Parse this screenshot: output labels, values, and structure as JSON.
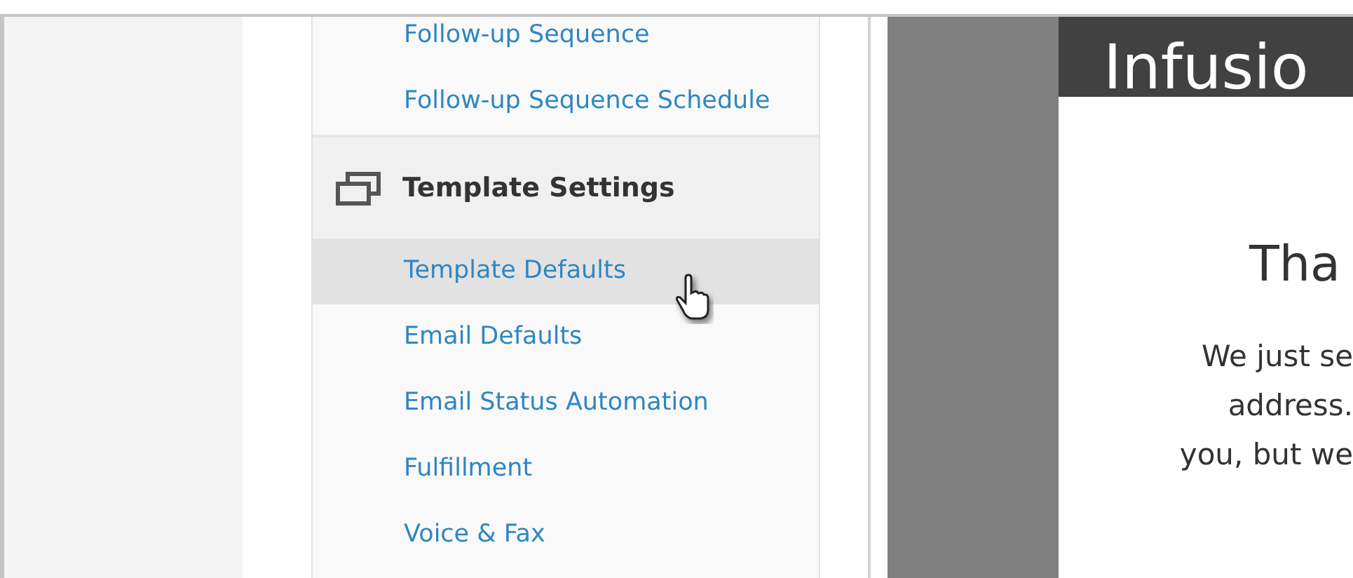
{
  "sidebar": {
    "items": [
      {
        "kind": "link",
        "label": "Follow-up Sequence",
        "selected": false
      },
      {
        "kind": "link",
        "label": "Follow-up Sequence Schedule",
        "selected": false
      },
      {
        "kind": "section",
        "label": "Template Settings"
      },
      {
        "kind": "link",
        "label": "Template Defaults",
        "selected": true
      },
      {
        "kind": "link",
        "label": "Email Defaults",
        "selected": false
      },
      {
        "kind": "link",
        "label": "Email Status Automation",
        "selected": false
      },
      {
        "kind": "link",
        "label": "Fulfillment",
        "selected": false
      },
      {
        "kind": "link",
        "label": "Voice & Fax",
        "selected": false
      }
    ]
  },
  "preview": {
    "header": "Infusio",
    "heading": "Tha",
    "lines": [
      "We just se",
      "address.",
      "you, but we"
    ]
  }
}
